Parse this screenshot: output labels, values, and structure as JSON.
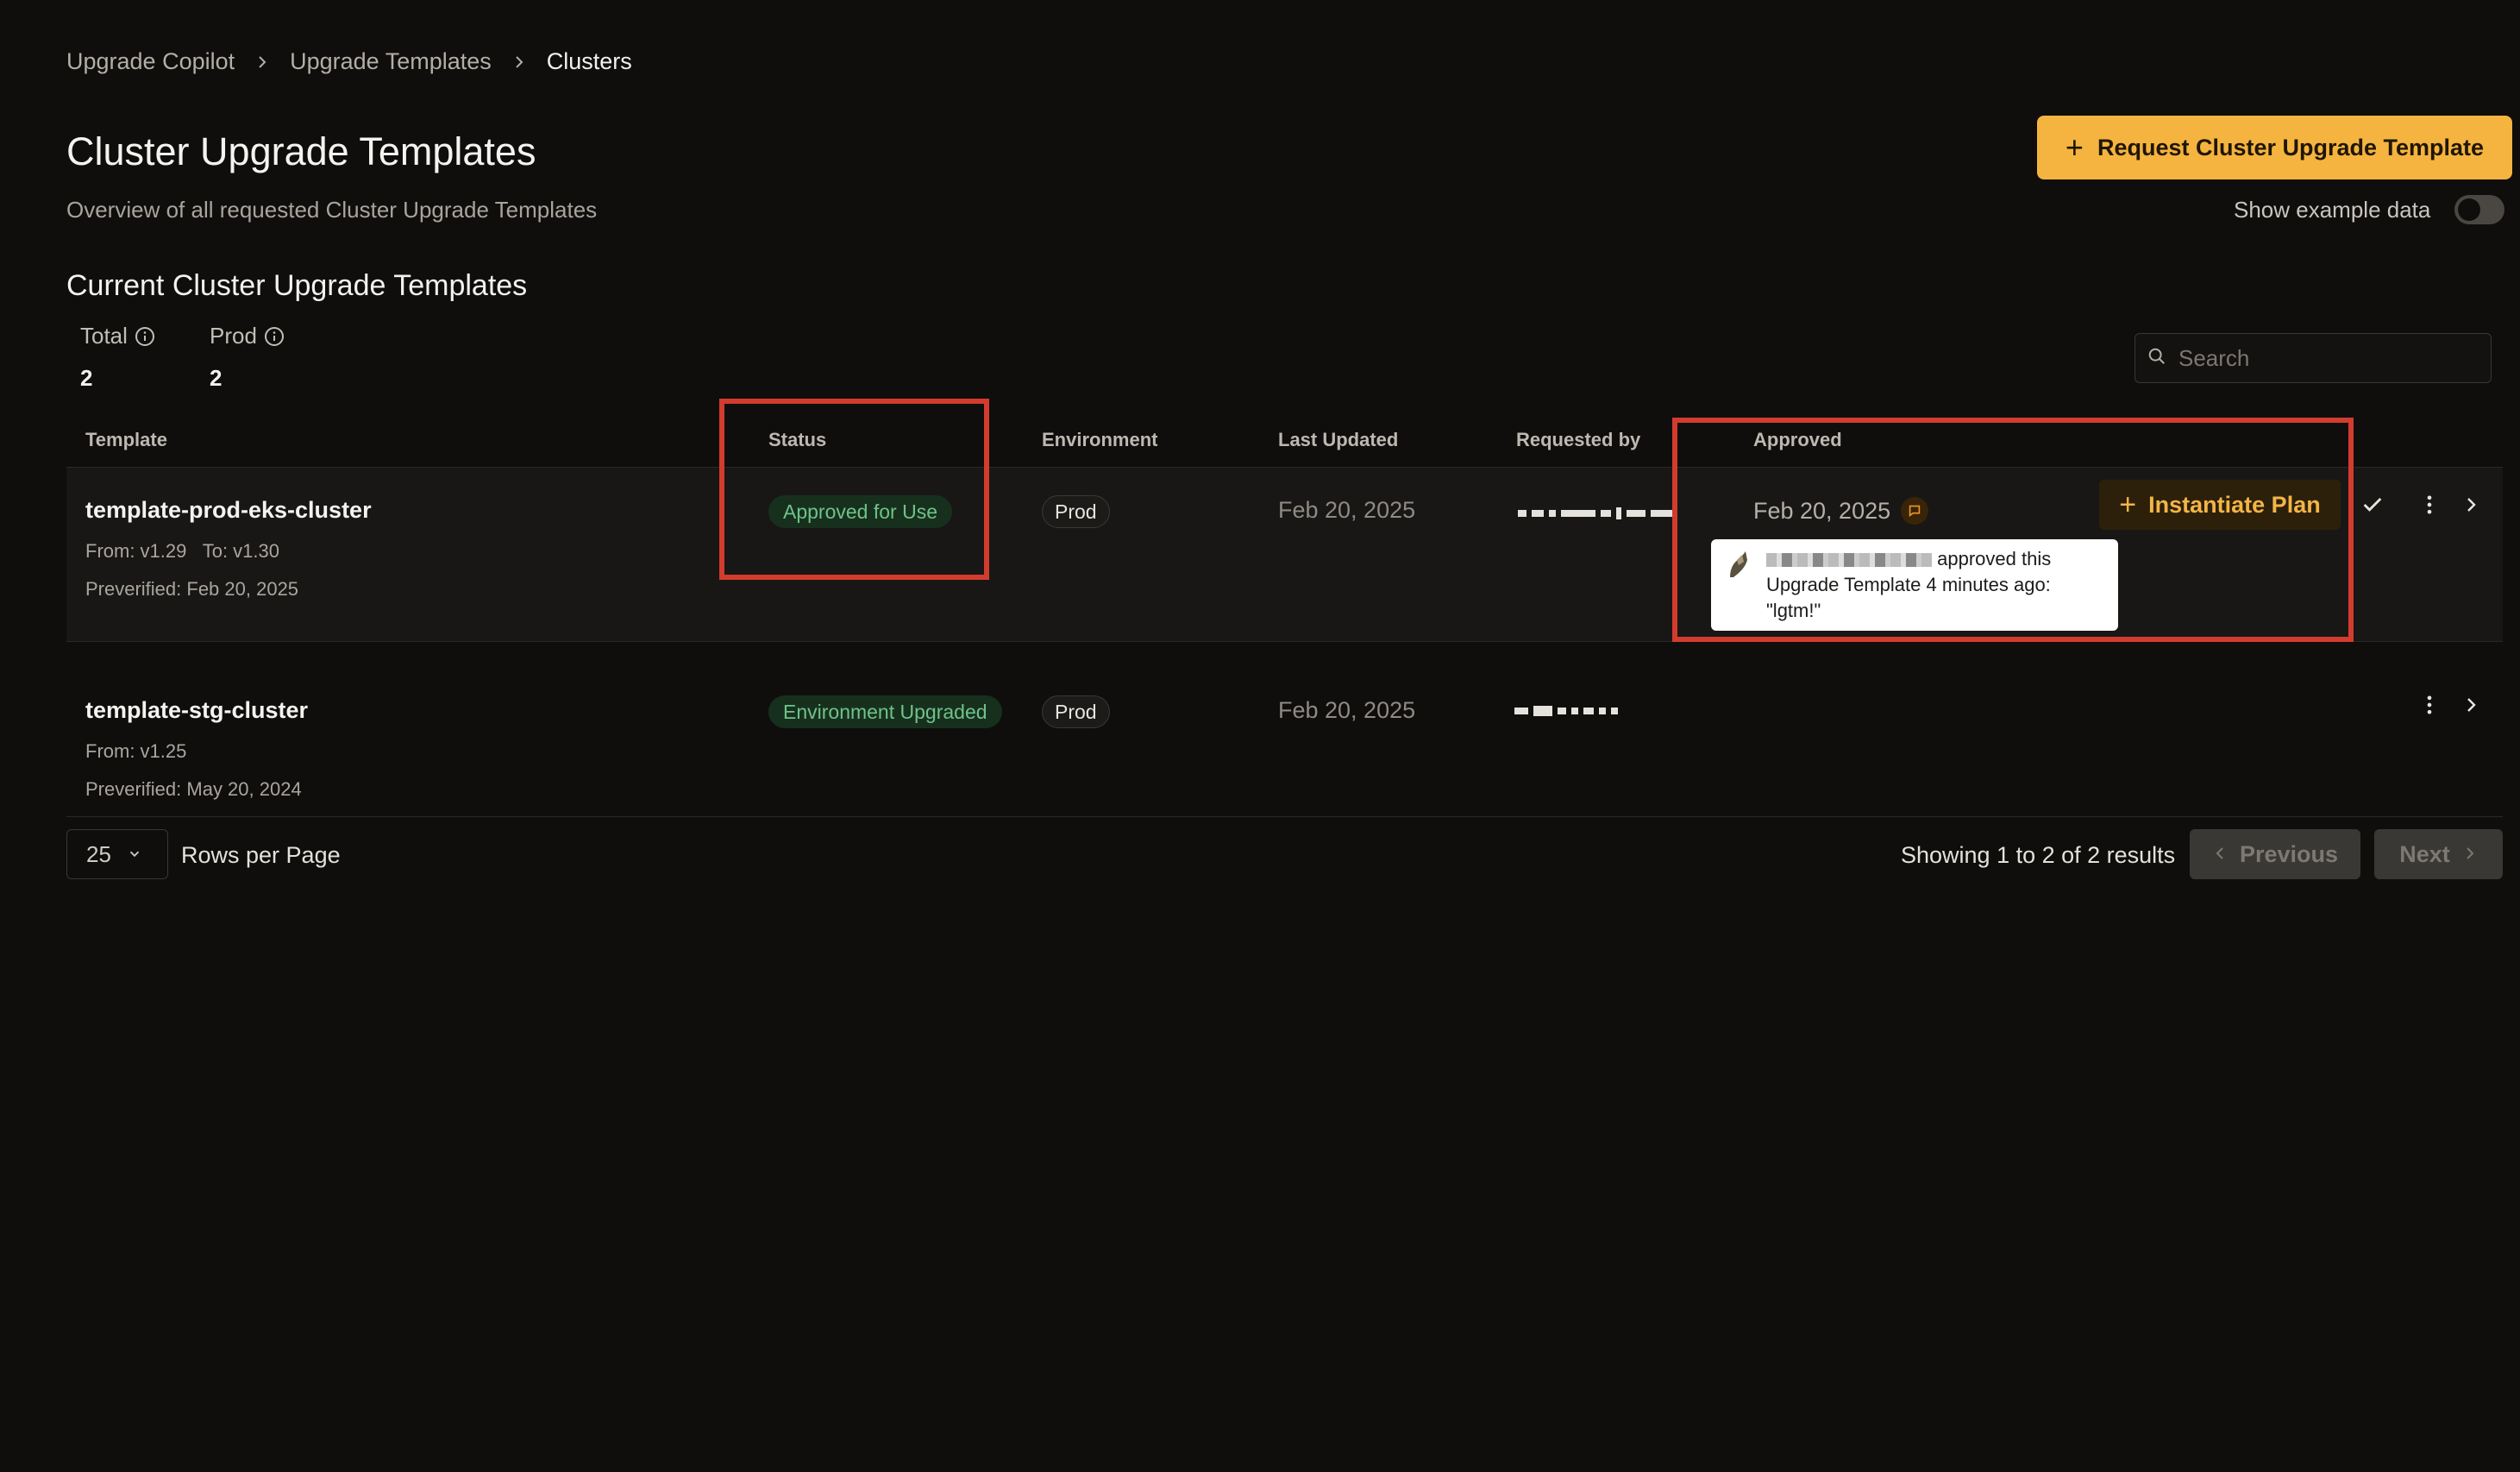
{
  "breadcrumb": [
    "Upgrade Copilot",
    "Upgrade Templates",
    "Clusters"
  ],
  "header": {
    "title": "Cluster Upgrade Templates",
    "subtitle": "Overview of all requested Cluster Upgrade Templates",
    "request_button": "Request Cluster Upgrade Template",
    "toggle_label": "Show example data",
    "toggle_on": false
  },
  "section": {
    "title": "Current Cluster Upgrade Templates",
    "stats": [
      {
        "label": "Total",
        "value": "2"
      },
      {
        "label": "Prod",
        "value": "2"
      }
    ],
    "search_placeholder": "Search"
  },
  "table": {
    "columns": [
      "Template",
      "Status",
      "Environment",
      "Last Updated",
      "Requested by",
      "Approved"
    ],
    "rows": [
      {
        "name": "template-prod-eks-cluster",
        "from": "From: v1.29",
        "to": "To: v1.30",
        "preverified": "Preverified: Feb 20, 2025",
        "status": "Approved for Use",
        "environment": "Prod",
        "last_updated": "Feb 20, 2025",
        "approved": "Feb 20, 2025",
        "action": "Instantiate Plan"
      },
      {
        "name": "template-stg-cluster",
        "from": "From: v1.25",
        "preverified": "Preverified: May 20, 2024",
        "status": "Environment Upgraded",
        "environment": "Prod",
        "last_updated": "Feb 20, 2025"
      }
    ]
  },
  "tooltip": {
    "text_1": "approved this",
    "text_2": "Upgrade Template 4 minutes ago:",
    "text_3": "\"lgtm!\""
  },
  "pagination": {
    "rows_per_page": "25",
    "rows_label": "Rows per Page",
    "showing": "Showing 1 to 2 of 2 results",
    "previous": "Previous",
    "next": "Next"
  },
  "colors": {
    "accent": "#f5b43f",
    "highlight_box": "#d23c2e",
    "status_green": "#6fc388"
  }
}
